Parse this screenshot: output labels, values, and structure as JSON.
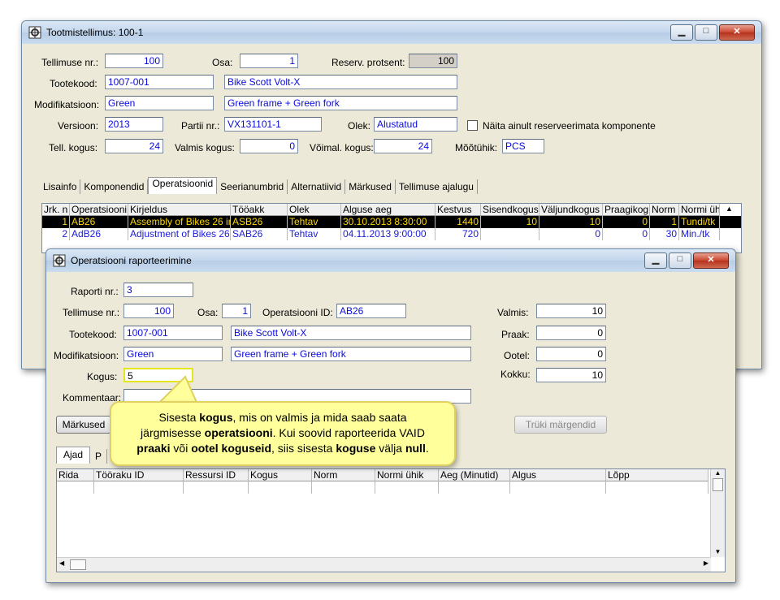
{
  "main_window": {
    "title": "Tootmistellimus: 100-1",
    "labels": {
      "tellimuse_nr": "Tellimuse nr.:",
      "osa": "Osa:",
      "reserv": "Reserv. protsent:",
      "tootekood": "Tootekood:",
      "modifikatsioon": "Modifikatsioon:",
      "versioon": "Versioon:",
      "partii": "Partii nr.:",
      "olek": "Olek:",
      "naita": "Näita ainult reserveerimata komponente",
      "tell_kogus": "Tell. kogus:",
      "valmis_kogus": "Valmis kogus:",
      "voimal_kogus": "Võimal. kogus:",
      "mootuhik": "Mõõtühik:"
    },
    "values": {
      "tellimuse_nr": "100",
      "osa": "1",
      "reserv": "100",
      "tootekood": "1007-001",
      "toote_nimi": "Bike Scott Volt-X",
      "modifikatsioon": "Green",
      "mod_kirjeldus": "Green frame + Green fork",
      "versioon": "2013",
      "partii": "VX131101-1",
      "olek": "Alustatud",
      "tell_kogus": "24",
      "valmis_kogus": "0",
      "voimal_kogus": "24",
      "mootuhik": "PCS"
    },
    "tabs": [
      "Lisainfo",
      "Komponendid",
      "Operatsioonid",
      "Seerianumbrid",
      "Alternatiivid",
      "Märkused",
      "Tellimuse ajalugu"
    ],
    "grid_headers": [
      "Jrk. n",
      "Operatsiooni",
      "Kirjeldus",
      "Tööakk",
      "Olek",
      "Alguse aeg",
      "Kestvus",
      "Sisendkogus",
      "Väljundkogus",
      "Praagikog",
      "Norm",
      "Normi üh"
    ],
    "grid_rows": [
      [
        "1",
        "AB26",
        "Assembly of Bikes 26 in",
        "ASB26",
        "Tehtav",
        "30.10.2013 8:30:00",
        "1440",
        "10",
        "10",
        "0",
        "1",
        "Tundi/tk"
      ],
      [
        "2",
        "AdB26",
        "Adjustment of Bikes 26",
        "SAB26",
        "Tehtav",
        "04.11.2013 9:00:00",
        "720",
        "",
        "0",
        "0",
        "30",
        "Min./tk"
      ]
    ]
  },
  "dialog": {
    "title": "Operatsiooni raporteerimine",
    "labels": {
      "raporti_nr": "Raporti nr.:",
      "tellimuse_nr": "Tellimuse nr.:",
      "osa": "Osa:",
      "operatsiooni_id": "Operatsiooni ID:",
      "valmis": "Valmis:",
      "tootekood": "Tootekood:",
      "praak": "Praak:",
      "modifikatsioon": "Modifikatsioon:",
      "ootel": "Ootel:",
      "kogus": "Kogus:",
      "kokku": "Kokku:",
      "kommentaar": "Kommentaar:"
    },
    "values": {
      "raporti_nr": "3",
      "tellimuse_nr": "100",
      "osa": "1",
      "operatsiooni_id": "AB26",
      "valmis": "10",
      "tootekood": "1007-001",
      "toote_nimi": "Bike Scott Volt-X",
      "praak": "0",
      "modifikatsioon": "Green",
      "mod_kirjeldus": "Green frame + Green fork",
      "ootel": "0",
      "kogus": "5",
      "kokku": "10",
      "kommentaar": ""
    },
    "buttons": {
      "markused": "Märkused",
      "truki": "Trüki märgendid"
    },
    "tabs": [
      "Ajad",
      "P"
    ],
    "grid_headers": [
      "Rida",
      "Tööraku ID",
      "Ressursi ID",
      "Kogus",
      "Norm",
      "Normi ühik",
      "Aeg (Minutid)",
      "Algus",
      "Lõpp"
    ]
  },
  "tooltip": {
    "t1": "Sisesta ",
    "b1": "kogus",
    "t2": ", mis on valmis ja mida saab  saata",
    "t3": "järgmisesse ",
    "b2": "operatsiooni",
    "t4": ".  Kui soovid raporteerida VAID",
    "b3": "praaki",
    "t5": " või ",
    "b4": "ootel koguseid",
    "t6": ", siis sisesta ",
    "b5": "koguse",
    "t7": " välja ",
    "b6": "null",
    "t8": "."
  }
}
